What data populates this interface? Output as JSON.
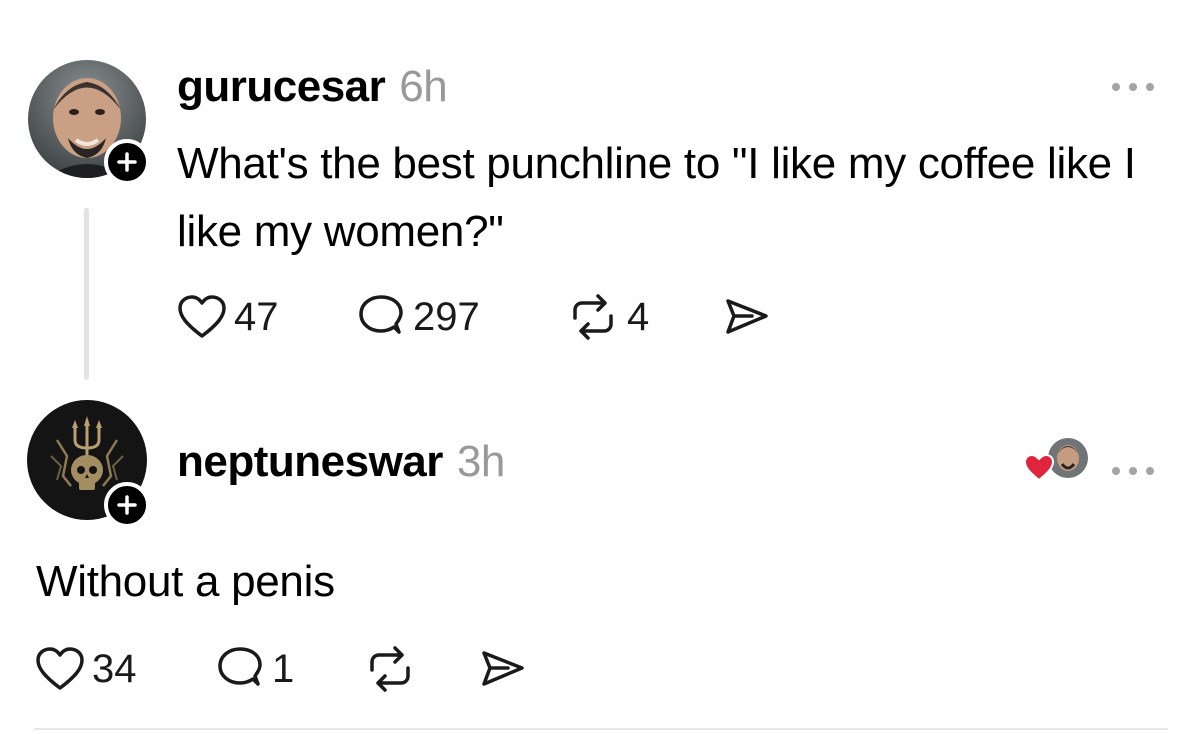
{
  "posts": [
    {
      "username": "gurucesar",
      "time": "6h",
      "text": "What's the best punchline to \"I like my coffee like I like my women?\"",
      "likes": "47",
      "replies": "297",
      "reposts": "4"
    },
    {
      "username": "neptuneswar",
      "time": "3h",
      "text": "Without a penis",
      "likes": "34",
      "replies": "1",
      "reposts": ""
    }
  ],
  "icons": {
    "follow": "plus-icon",
    "more": "more-dots-icon",
    "like": "heart-icon",
    "reply": "speech-bubble-icon",
    "repost": "repost-icon",
    "share": "send-icon",
    "liked_by": "red-heart-icon"
  },
  "colors": {
    "text": "#000000",
    "secondary": "#999999",
    "like_red": "#e0243b"
  }
}
